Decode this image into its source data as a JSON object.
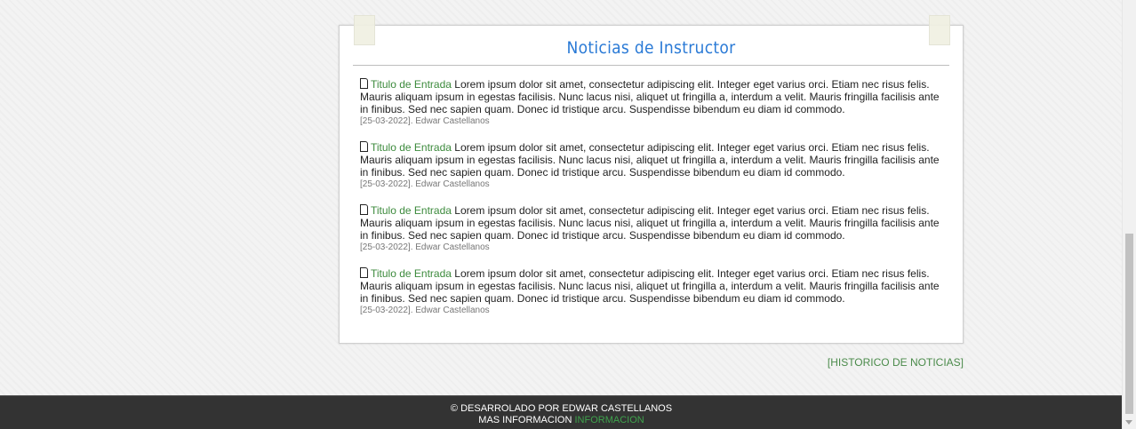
{
  "panel": {
    "title": "Noticias de Instructor",
    "items": [
      {
        "title": "Titulo de Entrada",
        "text": "Lorem ipsum dolor sit amet, consectetur adipiscing elit. Integer eget varius orci. Etiam nec risus felis. Mauris aliquam ipsum in egestas facilisis. Nunc lacus nisi, aliquet ut fringilla a, interdum a velit. Mauris fringilla facilisis ante in finibus. Sed nec sapien quam. Donec id tristique arcu. Suspendisse bibendum eu diam id commodo.",
        "meta": "[25-03-2022]. Edwar Castellanos"
      },
      {
        "title": "Titulo de Entrada",
        "text": "Lorem ipsum dolor sit amet, consectetur adipiscing elit. Integer eget varius orci. Etiam nec risus felis. Mauris aliquam ipsum in egestas facilisis. Nunc lacus nisi, aliquet ut fringilla a, interdum a velit. Mauris fringilla facilisis ante in finibus. Sed nec sapien quam. Donec id tristique arcu. Suspendisse bibendum eu diam id commodo.",
        "meta": "[25-03-2022]. Edwar Castellanos"
      },
      {
        "title": "Titulo de Entrada",
        "text": "Lorem ipsum dolor sit amet, consectetur adipiscing elit. Integer eget varius orci. Etiam nec risus felis. Mauris aliquam ipsum in egestas facilisis. Nunc lacus nisi, aliquet ut fringilla a, interdum a velit. Mauris fringilla facilisis ante in finibus. Sed nec sapien quam. Donec id tristique arcu. Suspendisse bibendum eu diam id commodo.",
        "meta": "[25-03-2022]. Edwar Castellanos"
      },
      {
        "title": "Titulo de Entrada",
        "text": "Lorem ipsum dolor sit amet, consectetur adipiscing elit. Integer eget varius orci. Etiam nec risus felis. Mauris aliquam ipsum in egestas facilisis. Nunc lacus nisi, aliquet ut fringilla a, interdum a velit. Mauris fringilla facilisis ante in finibus. Sed nec sapien quam. Donec id tristique arcu. Suspendisse bibendum eu diam id commodo.",
        "meta": "[25-03-2022]. Edwar Castellanos"
      }
    ]
  },
  "history_link": "[HISTORICO DE NOTICIAS]",
  "footer": {
    "credit": "© DESARROLADO POR EDWAR CASTELLANOS",
    "more_label": "MAS INFORMACION",
    "more_link": "INFORMACION"
  },
  "colors": {
    "title": "#2a7ad6",
    "entry_title": "#3c8a3c",
    "footer_bg": "#333333",
    "footer_link": "#3fa34d"
  },
  "icons": [
    "document-icon"
  ]
}
